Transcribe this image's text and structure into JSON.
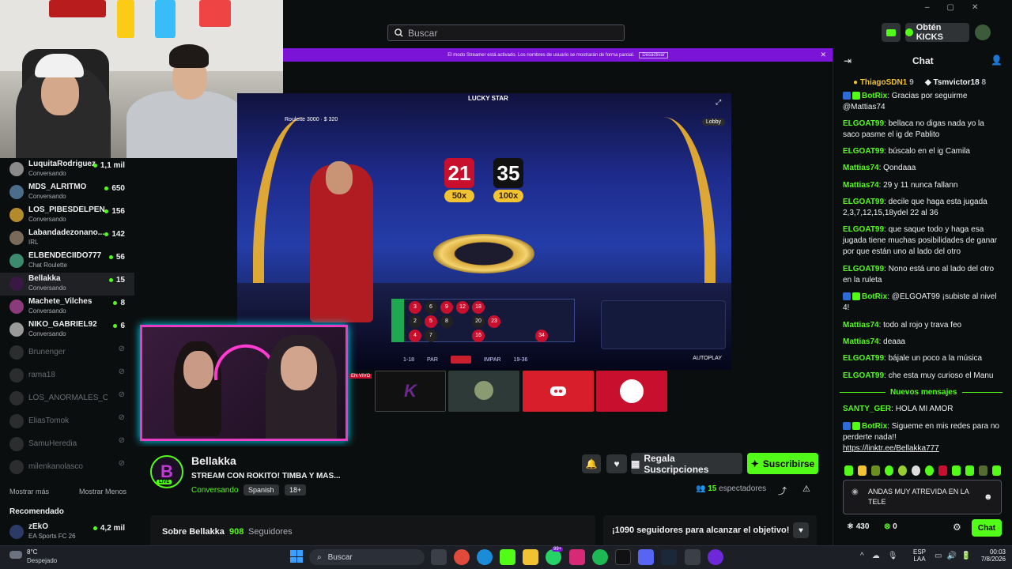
{
  "search": {
    "placeholder": "Buscar"
  },
  "topbar": {
    "kicks_label": "Obtén KICKS"
  },
  "banner": {
    "text": "El modo Streamer está activado. Los nombres de usuario se mostrarán de forma parcial.",
    "disable_label": "Desactivar"
  },
  "sidebar": {
    "channels": [
      {
        "name": "LuquitaRodriguez",
        "category": "Conversando",
        "viewers": "1,1 mil"
      },
      {
        "name": "MDS_ALRITMO",
        "category": "Conversando",
        "viewers": "650"
      },
      {
        "name": "LOS_PIBESDELPEN...",
        "category": "Conversando",
        "viewers": "156"
      },
      {
        "name": "Labandadezonano...",
        "category": "IRL",
        "viewers": "142"
      },
      {
        "name": "ELBENDECIIDO777",
        "category": "Chat Roulette",
        "viewers": "56"
      },
      {
        "name": "Bellakka",
        "category": "Conversando",
        "viewers": "15"
      },
      {
        "name": "Machete_Vilches",
        "category": "Conversando",
        "viewers": "8"
      },
      {
        "name": "NIKO_GABRIEL92",
        "category": "Conversando",
        "viewers": "6"
      }
    ],
    "offline": [
      "Brunenger",
      "rama18",
      "LOS_ANORMALES_OF...",
      "EliasTomok",
      "SamuHeredia",
      "milenkanolasco"
    ],
    "show_more": "Mostrar más",
    "show_less": "Mostrar Menos",
    "recommended_title": "Recomendado",
    "recommended": {
      "name": "zEkO",
      "category": "EA Sports FC 26",
      "viewers": "4,2 mil"
    }
  },
  "video": {
    "logo": "LUCKY STAR",
    "table_label": "Roulette 3000 · $ 320",
    "lobby": "Lobby",
    "num1": "21",
    "mult1": "50x",
    "num2": "35",
    "mult2": "100x",
    "bottom": [
      "1-18",
      "PAR",
      "IMPAR",
      "19-36"
    ],
    "autoplay": "AUTOPLAY",
    "live_tag": "EN VIVO"
  },
  "stream": {
    "channel_name": "Bellakka",
    "title": "STREAM CON ROKITO! TIMBA Y MAS...",
    "category": "Conversando",
    "language": "Spanish",
    "rating": "18+",
    "live": "LIVE",
    "viewers": "15",
    "viewers_label": "espectadores",
    "gift_label": "Regala Suscripciones",
    "subscribe_label": "Suscribirse",
    "about_label": "Sobre Bellakka",
    "followers_count": "908",
    "followers_label": "Seguidores",
    "goal_text": "¡1090 seguidores para alcanzar el objetivo!"
  },
  "chat": {
    "title": "Chat",
    "top_users": [
      {
        "name": "ThiagoSDN1",
        "count": "9"
      },
      {
        "name": "Tsmvictor18",
        "count": "8"
      }
    ],
    "messages": [
      {
        "user": "BotRix",
        "text": "Gracias por seguirme @Mattias74"
      },
      {
        "user": "ELGOAT99",
        "text": "bellaca no digas nada yo la saco pasme el ig de Pablito"
      },
      {
        "user": "ELGOAT99",
        "text": "búscalo en el ig Camila"
      },
      {
        "user": "Mattias74",
        "text": "Qondaaa"
      },
      {
        "user": "Mattias74",
        "text": "29 y 11 nunca fallann"
      },
      {
        "user": "ELGOAT99",
        "text": "decile que haga esta jugada 2,3,7,12,15,18ydel 22 al 36"
      },
      {
        "user": "ELGOAT99",
        "text": "que saque todo y haga esa jugada tiene muchas posibilidades de ganar por que están uno al lado del otro"
      },
      {
        "user": "ELGOAT99",
        "text": "Nono está uno al lado del otro en la ruleta"
      },
      {
        "user": "BotRix",
        "text": "@ELGOAT99 ¡subiste al nivel 4!"
      },
      {
        "user": "Mattias74",
        "text": "todo al rojo y trava feo"
      },
      {
        "user": "Mattias74",
        "text": "deaaa"
      },
      {
        "user": "ELGOAT99",
        "text": "bájale un poco a la música"
      },
      {
        "user": "ELGOAT99",
        "text": "che esta muy curioso el Manu"
      }
    ],
    "new_messages": "Nuevos mensajes",
    "new_msgs": [
      {
        "user": "SANTY_GER",
        "text": "HOLA MI AMOR"
      },
      {
        "user": "BotRix",
        "text": "Sigueme en mis redes para no perderte nada!!"
      }
    ],
    "link": "https://linktr.ee/Bellakka777",
    "input_value": "ANDAS MUY ATREVIDA EN LA TELE",
    "points": "430",
    "kicks": "0",
    "send_label": "Chat"
  },
  "taskbar": {
    "temp": "8°C",
    "weather": "Despejado",
    "search": "Buscar",
    "lang1": "ESP",
    "lang2": "LAA",
    "time": "00:03",
    "date": "7/8/2026",
    "badge": "99+"
  }
}
